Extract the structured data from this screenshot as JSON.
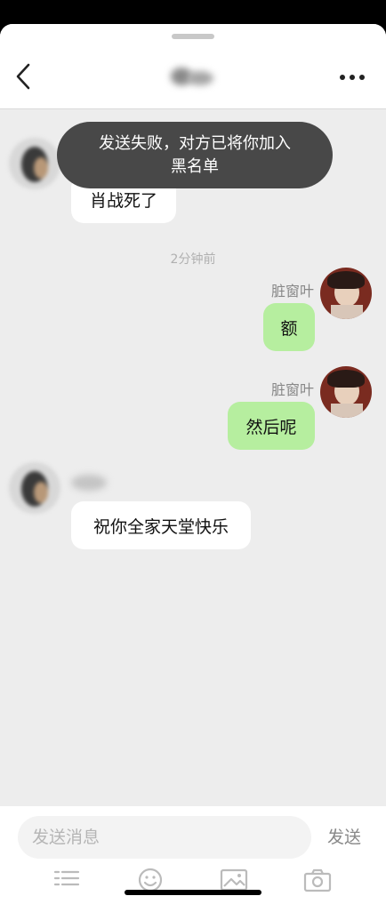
{
  "header": {
    "back_icon": "chevron-left-icon",
    "more_icon": "ellipsis-icon"
  },
  "toast": {
    "line1": "发送失败，对方已将你加入",
    "line2": "黑名单"
  },
  "messages": [
    {
      "direction": "incoming",
      "text": "肖战死了"
    },
    {
      "direction": "outgoing",
      "sender": "脏窗叶",
      "text": "额"
    },
    {
      "direction": "outgoing",
      "sender": "脏窗叶",
      "text": "然后呢"
    },
    {
      "direction": "incoming",
      "text": "祝你全家天堂快乐"
    }
  ],
  "timestamp": "2分钟前",
  "input": {
    "placeholder": "发送消息",
    "send_label": "发送"
  },
  "toolbar": [
    "keyboard-icon",
    "emoji-icon",
    "image-icon",
    "camera-icon"
  ],
  "colors": {
    "outgoing_bubble": "#b6ee9f",
    "incoming_bubble": "#ffffff",
    "chat_background": "#ededed",
    "toast_background": "#484848"
  }
}
